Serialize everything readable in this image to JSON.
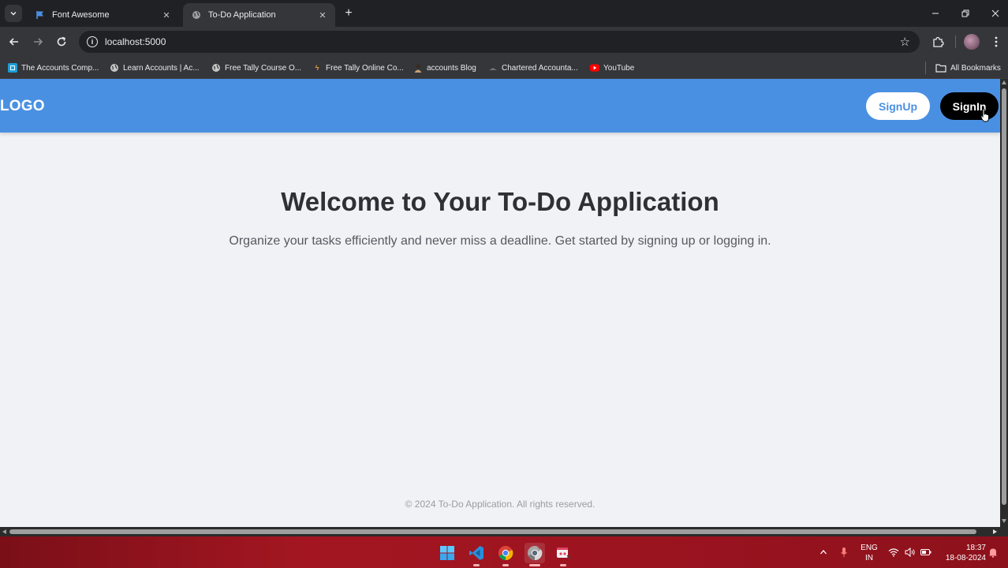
{
  "browser": {
    "tabs": [
      {
        "title": "Font Awesome",
        "active": false,
        "favicon": "flag-icon"
      },
      {
        "title": "To-Do Application",
        "active": true,
        "favicon": "globe-icon"
      }
    ],
    "url": "localhost:5000",
    "bookmarks": [
      {
        "label": "The Accounts Comp...",
        "icon": "site-icon"
      },
      {
        "label": "Learn Accounts | Ac...",
        "icon": "globe-icon"
      },
      {
        "label": "Free Tally Course O...",
        "icon": "globe-icon"
      },
      {
        "label": "Free Tally Online Co...",
        "icon": "tally-icon"
      },
      {
        "label": "accounts Blog",
        "icon": "avatar-icon"
      },
      {
        "label": "Chartered Accounta...",
        "icon": "site-icon"
      },
      {
        "label": "YouTube",
        "icon": "youtube-icon"
      }
    ],
    "all_bookmarks_label": "All Bookmarks"
  },
  "page": {
    "logo": "LOGO",
    "signup_label": "SignUp",
    "signin_label": "SignIn",
    "hero_title": "Welcome to Your To-Do Application",
    "hero_subtitle": "Organize your tasks efficiently and never miss a deadline. Get started by signing up or logging in.",
    "footer": "© 2024 To-Do Application. All rights reserved.",
    "colors": {
      "header": "#4a90e2",
      "background": "#f1f2f6",
      "signin": "#000000",
      "signup_text": "#4a90e2"
    }
  },
  "taskbar": {
    "apps": [
      "windows-start-icon",
      "vscode-icon",
      "chrome-icon",
      "chrome-dev-icon",
      "snipping-tool-icon"
    ],
    "lang_line1": "ENG",
    "lang_line2": "IN",
    "time": "18:37",
    "date": "18-08-2024"
  }
}
